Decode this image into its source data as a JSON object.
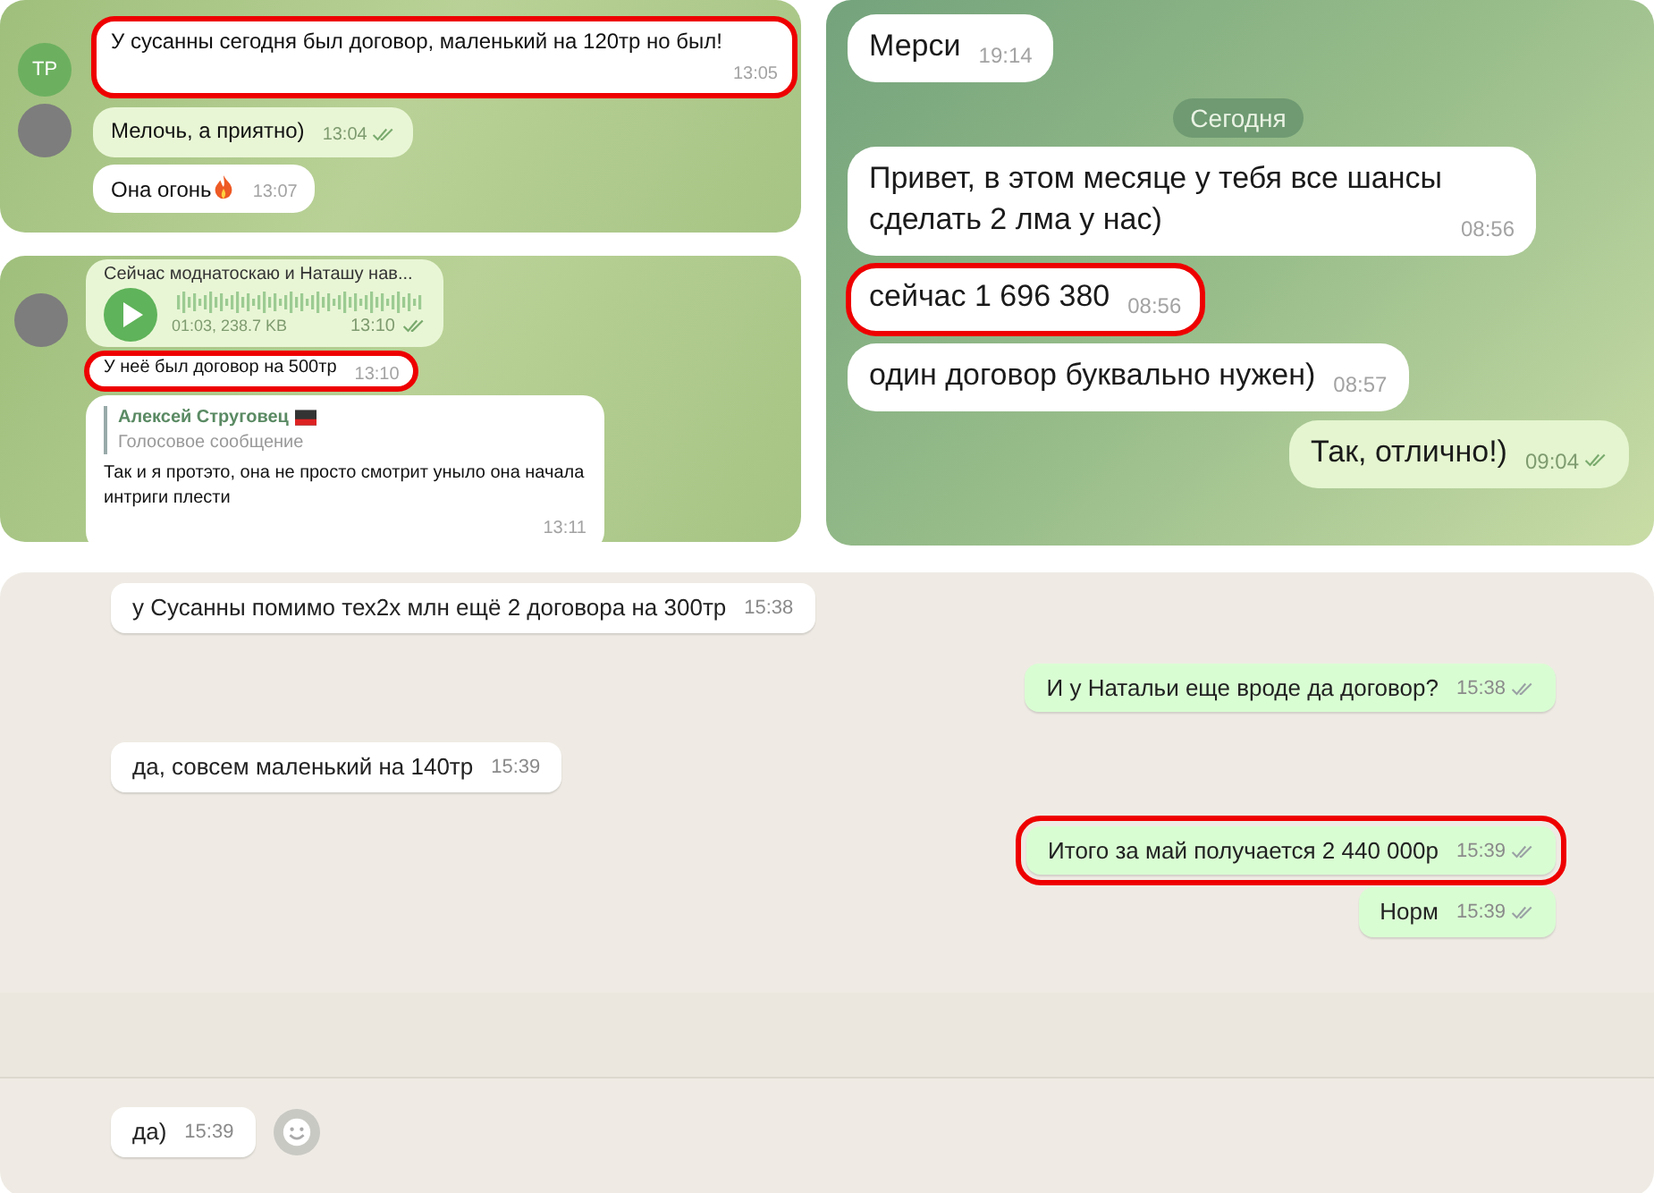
{
  "panels": [
    {
      "kind": "telegram-desktop",
      "sections": [
        {
          "messages": [
            {
              "kind": "text",
              "outgoing": false,
              "text": "У сусанны сегодня был договор, маленький на 120тр но был!",
              "time": "13:05",
              "read": false,
              "highlighted": true,
              "avatar": {
                "kind": "initials",
                "text": "ТР"
              }
            },
            {
              "kind": "text",
              "outgoing": true,
              "text": "Мелочь, а приятно)",
              "time": "13:04",
              "read": true,
              "highlighted": false,
              "avatar": {
                "kind": "photo"
              }
            },
            {
              "kind": "text",
              "outgoing": false,
              "text": "Она огонь",
              "flame_icon": true,
              "time": "13:07",
              "read": false,
              "highlighted": false
            }
          ]
        }
      ]
    },
    {
      "kind": "telegram-desktop",
      "sections": [
        {
          "messages": [
            {
              "kind": "voice",
              "outgoing": true,
              "caption": "Сейчас моднатоскаю и Наташу нав...",
              "duration": "01:03, 238.7 KB",
              "time": "13:10",
              "read": true,
              "highlighted": false,
              "avatar": {
                "kind": "photo"
              }
            },
            {
              "kind": "text",
              "outgoing": false,
              "text": "У неё был договор на 500тр",
              "time": "13:10",
              "read": false,
              "highlighted": true
            },
            {
              "kind": "reply",
              "outgoing": false,
              "sender": "Алексей Струговец",
              "flag_icon": true,
              "quote": "Голосовое сообщение",
              "text": "Так и я протэто, она не просто смотрит уныло она начала интриги плести",
              "time": "13:11",
              "read": false,
              "highlighted": false
            }
          ]
        }
      ]
    },
    {
      "kind": "telegram-mobile",
      "sections": [
        {
          "messages": [
            {
              "kind": "text",
              "outgoing": false,
              "text": "Мерси",
              "time": "19:14",
              "read": false,
              "highlighted": false
            },
            {
              "kind": "date",
              "text": "Сегодня"
            },
            {
              "kind": "text",
              "outgoing": false,
              "text": "Привет, в этом месяце у тебя все шансы сделать 2 лма у нас)",
              "time": "08:56",
              "read": false,
              "highlighted": false
            },
            {
              "kind": "text",
              "outgoing": false,
              "text": "сейчас 1 696 380",
              "time": "08:56",
              "read": false,
              "highlighted": true
            },
            {
              "kind": "text",
              "outgoing": false,
              "text": "один договор буквально нужен)",
              "time": "08:57",
              "read": false,
              "highlighted": false
            },
            {
              "kind": "text",
              "outgoing": true,
              "text": "Так, отлично!)",
              "time": "09:04",
              "read": true,
              "highlighted": false
            }
          ]
        }
      ]
    },
    {
      "kind": "whatsapp",
      "sections": [
        {
          "messages": [
            {
              "kind": "text",
              "outgoing": false,
              "text": "у Сусанны помимо тех2х млн ещё 2 договора на 300тр",
              "time": "15:38",
              "read": false,
              "highlighted": false
            },
            {
              "kind": "text",
              "outgoing": true,
              "text": "И у Натальи еще вроде да договор?",
              "time": "15:38",
              "read": true,
              "highlighted": false
            },
            {
              "kind": "text",
              "outgoing": false,
              "text": "да, совсем маленький на 140тр",
              "time": "15:39",
              "read": false,
              "highlighted": false
            },
            {
              "kind": "text",
              "outgoing": true,
              "text": "Итого за май получается 2 440 000р",
              "time": "15:39",
              "read": true,
              "highlighted": true
            },
            {
              "kind": "text",
              "outgoing": true,
              "text": "Норм",
              "time": "15:39",
              "read": true,
              "highlighted": false
            }
          ]
        },
        {
          "messages": [
            {
              "kind": "text",
              "outgoing": false,
              "text": "да)",
              "time": "15:39",
              "read": false,
              "highlighted": false,
              "reaction_button": true
            }
          ]
        }
      ]
    }
  ]
}
